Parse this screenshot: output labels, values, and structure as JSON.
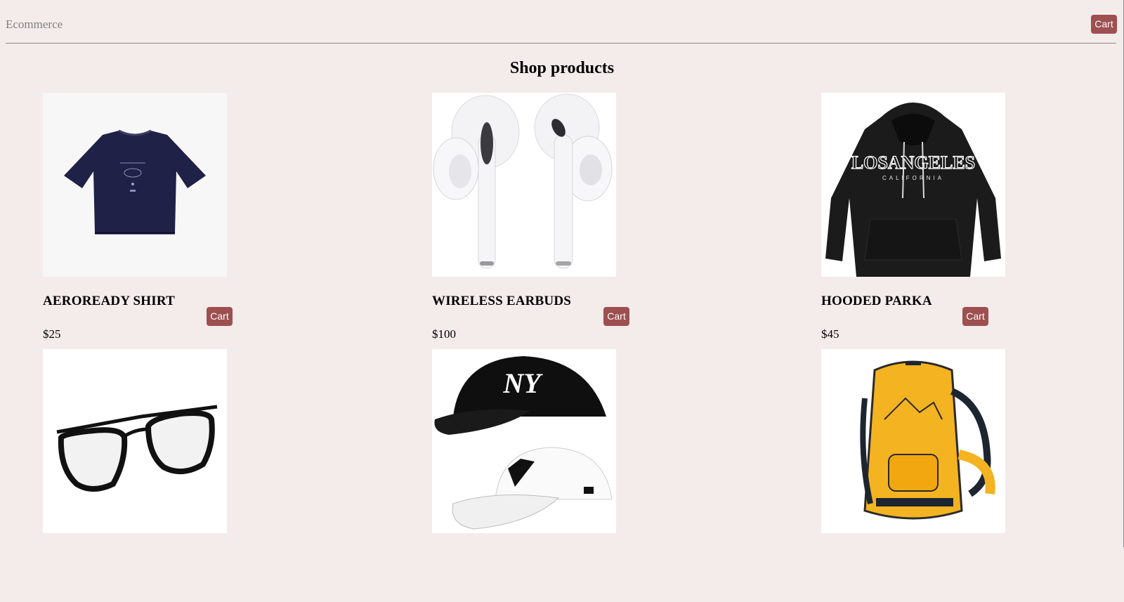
{
  "header": {
    "brand": "Ecommerce",
    "cart_label": "Cart"
  },
  "page_title": "Shop products",
  "products": [
    {
      "name": "AEROREADY SHIRT",
      "price": "$25",
      "cart_label": "Cart",
      "image": "navy-tshirt"
    },
    {
      "name": "WIRELESS EARBUDS",
      "price": "$100",
      "cart_label": "Cart",
      "image": "white-earbuds"
    },
    {
      "name": "HOODED PARKA",
      "price": "$45",
      "cart_label": "Cart",
      "image": "black-hoodie",
      "image_text": "LOSANGELES",
      "image_subtext": "CALIFORNIA"
    },
    {
      "image": "black-glasses"
    },
    {
      "image": "ny-caps"
    },
    {
      "image": "yellow-backpack"
    }
  ],
  "colors": {
    "background": "#f4ecea",
    "accent": "#9e4f4f"
  }
}
